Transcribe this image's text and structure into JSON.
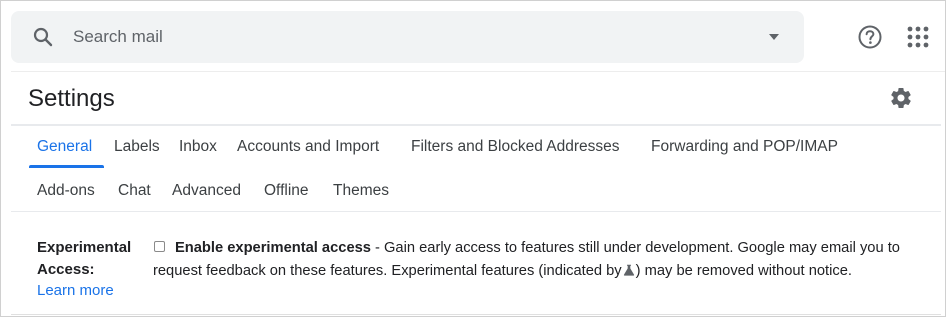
{
  "search": {
    "placeholder": "Search mail"
  },
  "settings": {
    "title": "Settings"
  },
  "tabs": [
    {
      "label": "General",
      "active": true
    },
    {
      "label": "Labels"
    },
    {
      "label": "Inbox"
    },
    {
      "label": "Accounts and Import"
    },
    {
      "label": "Filters and Blocked Addresses"
    },
    {
      "label": "Forwarding and POP/IMAP"
    },
    {
      "label": "Add-ons"
    },
    {
      "label": "Chat"
    },
    {
      "label": "Advanced"
    },
    {
      "label": "Offline"
    },
    {
      "label": "Themes"
    }
  ],
  "experimental": {
    "label": "Experimental Access:",
    "learn_more": "Learn more",
    "checkbox_checked": false,
    "enable_label": "Enable experimental access",
    "description_part1": " - Gain early access to features still under development. Google may email you to request feedback on these features. Experimental features (indicated by",
    "description_part2": ") may be removed without notice."
  },
  "icons": {
    "search": "search-icon",
    "dropdown": "chevron-down-icon",
    "help": "help-icon",
    "apps": "apps-grid-icon",
    "settings": "gear-icon",
    "experimental": "flask-icon"
  },
  "colors": {
    "accent": "#1a73e8",
    "search_bg": "#f1f3f4",
    "icon": "#5f6368",
    "text": "#202124"
  }
}
